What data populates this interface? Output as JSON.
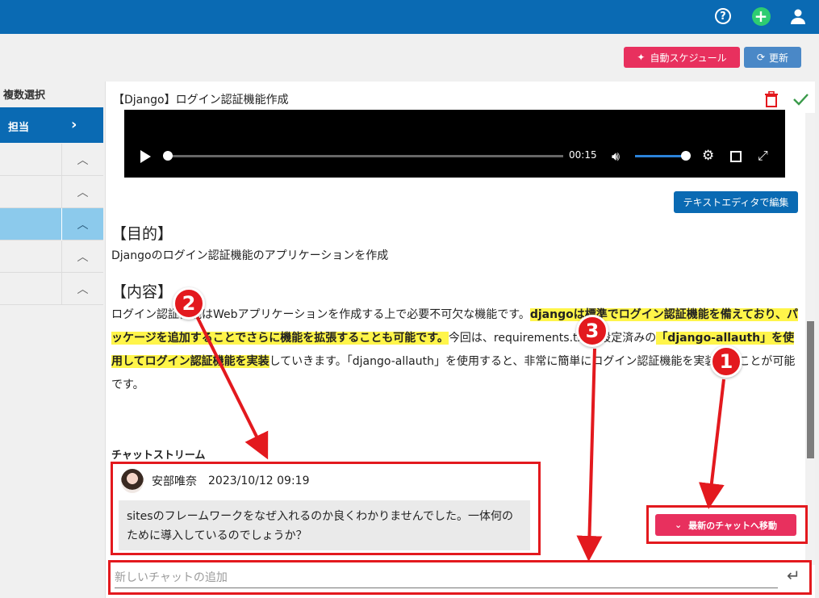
{
  "header": {
    "help_icon": "help-circle-icon",
    "add_icon": "plus-circle-icon",
    "user_icon": "user-icon"
  },
  "toolbar": {
    "auto_schedule_label": "自動スケジュール",
    "refresh_label": "更新"
  },
  "sidebar": {
    "title": "複数選択",
    "active_label": "担当",
    "active_icon": "chevron-right-icon",
    "rows": [
      "^",
      "^",
      "^",
      "^",
      "^"
    ]
  },
  "task": {
    "title": "【Django】ログイン認証機能作成",
    "video": {
      "time": "00:15",
      "progress": 0.01,
      "volume": 1.0
    },
    "edit_button": "テキストエディタで編集",
    "purpose_heading": "【目的】",
    "purpose_text": "Djangoのログイン認証機能のアプリケーションを作成",
    "content_heading": "【内容】",
    "content": {
      "p1": "ログイン認証機能はWebアプリケーションを作成する上で必要不可欠な機能です。",
      "p2": "djangoは標準でログイン認証機能を備えており、パッケージを追加することでさらに機能を拡張することも可能です。",
      "p3": "今回は、requirements.txtで設定済みの",
      "p4": "「django-allauth」を使用してログイン認証機能を実装",
      "p5": "していきます。「django-allauth」を使用すると、非常に簡単にログイン認証機能を実装することが可能です。"
    }
  },
  "chat": {
    "title": "チャットストリーム",
    "message": {
      "user": "安部唯奈",
      "date": "2023/10/12 09:19",
      "text": "sitesのフレームワークをなぜ入れるのか良くわかりませんでした。一体何のために導入しているのでしょうか？"
    },
    "latest_button": "最新のチャットへ移動",
    "input_placeholder": "新しいチャットの追加",
    "enter_icon": "return-icon"
  },
  "annotations": {
    "badge1": "1",
    "badge2": "2",
    "badge3": "3"
  },
  "colors": {
    "header": "#0a6ab3",
    "accent_pink": "#e8305e",
    "highlight": "#fff54a",
    "annotation_red": "#e3191e"
  }
}
